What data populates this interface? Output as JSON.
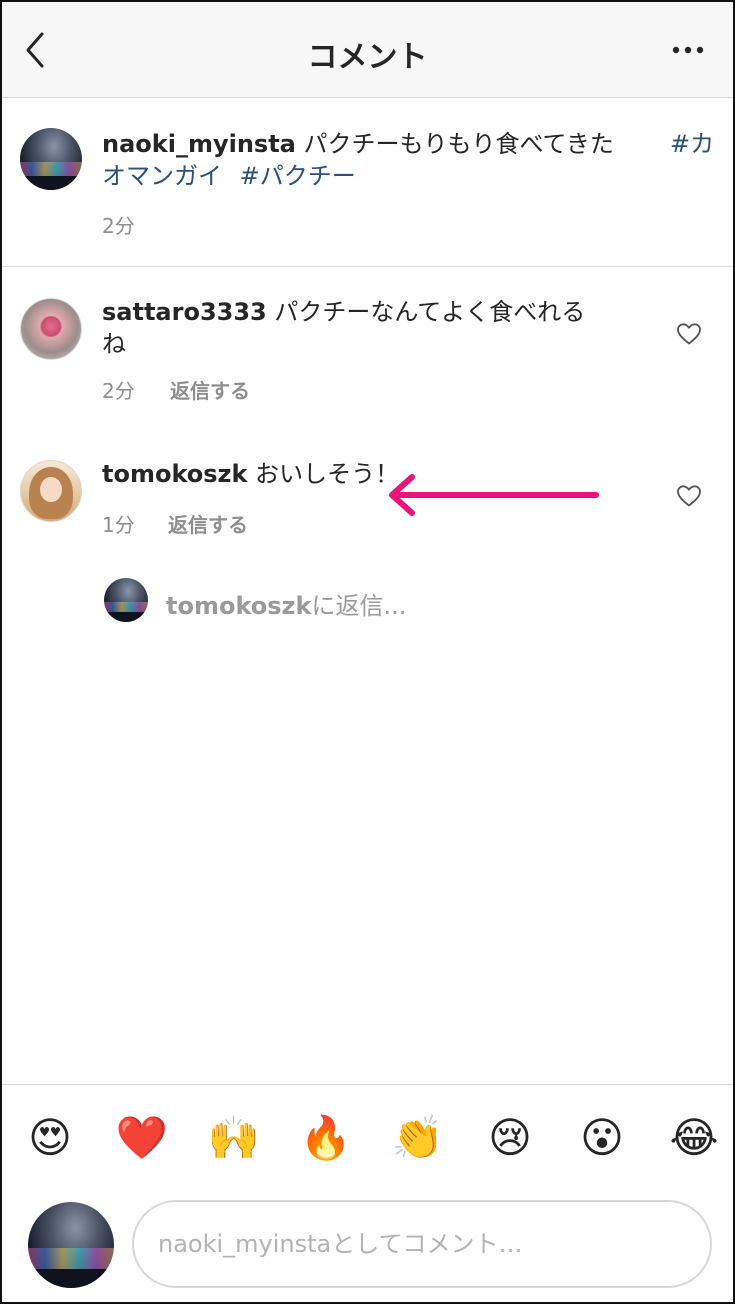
{
  "header": {
    "title": "コメント"
  },
  "post": {
    "username": "naoki_myinsta",
    "caption": "パクチーもりもり食べてきた",
    "hashtag1_line1": "#カ",
    "hashtag1_line2": "オマンガイ",
    "hashtag2": "#パクチー",
    "time": "2分"
  },
  "comments": [
    {
      "username": "sattaro3333",
      "text_line1": "パクチーなんてよく食べれる",
      "text_line2": "ね",
      "time": "2分",
      "reply_label": "返信する"
    },
    {
      "username": "tomokoszk",
      "text": "おいしそう！",
      "time": "1分",
      "reply_label": "返信する"
    }
  ],
  "reply_prompt": {
    "username": "tomokoszk",
    "suffix": "に返信..."
  },
  "emoji_bar": [
    "😍",
    "❤️",
    "🙌",
    "🔥",
    "👏",
    "😢",
    "😮",
    "😂"
  ],
  "input": {
    "placeholder": "naoki_myinstaとしてコメント…"
  },
  "colors": {
    "hashtag": "#2d4f7c",
    "arrow": "#e8157a",
    "meta": "#8e8e8e"
  }
}
